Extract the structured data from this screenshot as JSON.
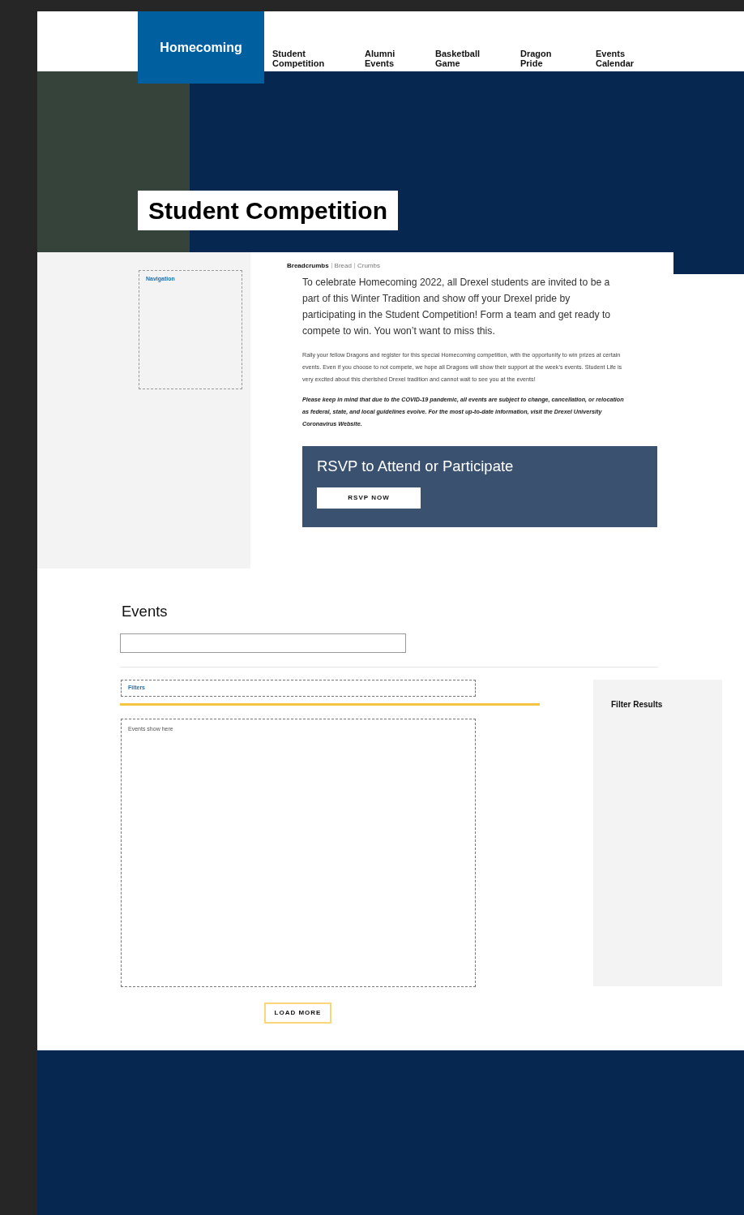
{
  "nav": {
    "tabs": [
      {
        "label": "Homecoming",
        "selected": true
      },
      {
        "label": "Student Competition",
        "selected": false
      },
      {
        "label": "Alumni Events",
        "selected": false
      },
      {
        "label": "Basketball Game",
        "selected": false
      },
      {
        "label": "Dragon Pride",
        "selected": false
      },
      {
        "label": "Events Calendar",
        "selected": false
      }
    ]
  },
  "hero": {
    "title": "Student Competition"
  },
  "sidebar": {
    "label": "Navigation"
  },
  "breadcrumbs": [
    "Breadcrumbs",
    "Bread",
    "Crumbs"
  ],
  "intro": "To celebrate Homecoming 2022, all Drexel students are invited to be a part of this Winter Tradition and show off your Drexel pride by participating in the Student Competition! Form a team and get ready to compete to win. You won’t want to miss this.",
  "body": "Rally your fellow Dragons and register for this special Homecoming competition, with the opportunity to win prizes at certain events. Even if you choose to not compete, we hope all Dragons will show their support at the week’s events. Student Life is very excited about this cherished Drexel tradition and cannot wait to see you at the events!",
  "notice": "Please keep in mind that due to the COVID-19 pandemic, all events are subject to change, cancellation, or relocation as federal, state, and local guidelines evolve. For the most up-to-date information, visit the Drexel University Coronavirus Website.",
  "rsvp": {
    "title": "RSVP to Attend or Participate",
    "button": "RSVP NOW"
  },
  "events": {
    "title": "Events",
    "filters": "Filters",
    "filter_results": "Filter Results",
    "placeholder_text": "Events show here",
    "load_more": "LOAD MORE"
  }
}
